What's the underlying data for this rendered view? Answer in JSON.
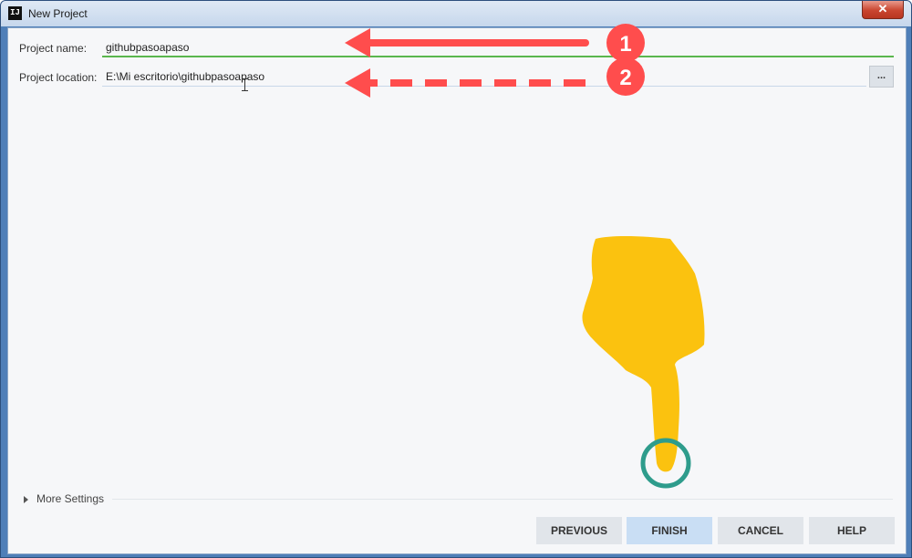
{
  "window": {
    "app_icon_text": "IJ",
    "title": "New Project",
    "close_glyph": "✕"
  },
  "form": {
    "project_name_label": "Project name:",
    "project_name_value": "githubpasoapaso",
    "project_location_label": "Project location:",
    "project_location_value": "E:\\Mi escritorio\\githubpasoapaso",
    "browse_label": "..."
  },
  "more_settings": {
    "label": "More Settings",
    "icon": "expand-triangle-icon"
  },
  "buttons": {
    "previous": "PREVIOUS",
    "finish": "FINISH",
    "cancel": "CANCEL",
    "help": "HELP"
  },
  "annotations": {
    "badge_1": "1",
    "badge_2": "2",
    "arrow_color": "#ff4d4d",
    "hand_color": "#fbc20f",
    "ring_color": "#2e9c8c",
    "arrow_1_style": "solid",
    "arrow_2_style": "dashed",
    "pointer_icon": "pointing-hand-icon"
  },
  "colors": {
    "active_field_underline": "#5ab74e",
    "finish_button_bg": "#c9def4",
    "close_button": "#c9452f",
    "window_frame": "#4f7fb8"
  }
}
